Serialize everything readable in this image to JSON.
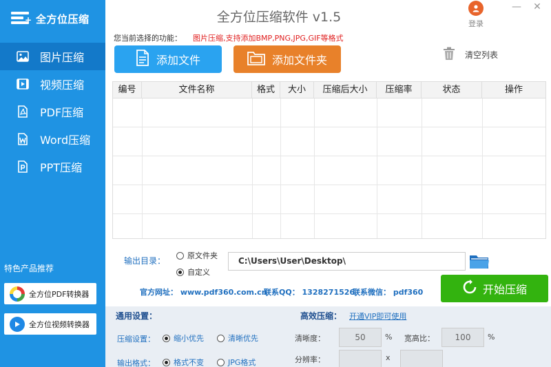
{
  "app": {
    "logo_text": "全方位压缩",
    "title": "全方位压缩软件 v1.5",
    "login_label": "登录",
    "minimize": "—",
    "close": "✕"
  },
  "sidebar": {
    "items": [
      {
        "label": "图片压缩",
        "icon": "image-icon",
        "active": true
      },
      {
        "label": "视频压缩",
        "icon": "video-icon",
        "active": false
      },
      {
        "label": "PDF压缩",
        "icon": "pdf-icon",
        "active": false
      },
      {
        "label": "Word压缩",
        "icon": "word-icon",
        "active": false
      },
      {
        "label": "PPT压缩",
        "icon": "ppt-icon",
        "active": false
      }
    ],
    "promo_title": "特色产品推荐",
    "promo": [
      {
        "label": "全方位PDF转换器",
        "icon": "pdf-converter-icon"
      },
      {
        "label": "全方位视频转换器",
        "icon": "video-converter-icon"
      }
    ]
  },
  "toolbar": {
    "func_label": "您当前选择的功能：",
    "func_desc": "图片压缩,支持添加BMP,PNG,JPG,GIF等格式",
    "add_file": "添加文件",
    "add_folder": "添加文件夹",
    "clear_list": "清空列表"
  },
  "table": {
    "columns": [
      "编号",
      "文件名称",
      "格式",
      "大小",
      "压缩后大小",
      "压缩率",
      "状态",
      "操作"
    ],
    "rows": []
  },
  "output": {
    "label": "输出目录：",
    "option_original": "原文件夹",
    "option_custom": "自定义",
    "selected": "custom",
    "path": "C:\\Users\\User\\Desktop\\"
  },
  "info": {
    "website": "官方网址：  www.pdf360.com.cn",
    "qq": "联系QQ：  1328271526",
    "wechat": "联系微信：  pdf360"
  },
  "start_label": "开始压缩",
  "settings": {
    "general_title": "通用设置：",
    "compress_label": "压缩设置：",
    "compress_opt1": "缩小优先",
    "compress_opt2": "清晰优先",
    "format_label": "输出格式：",
    "format_opt1": "格式不变",
    "format_opt2": "JPG格式",
    "hq_title": "高效压缩：",
    "vip_link": "开通VIP即可使用",
    "clarity_label": "清晰度：",
    "clarity_value": "50",
    "clarity_unit": "%",
    "ratio_label": "宽高比：",
    "ratio_value": "100",
    "ratio_unit": "%",
    "resolution_label": "分辨率：",
    "resolution_x": "x"
  },
  "colors": {
    "sidebar": "#1f93e3",
    "sidebar_active": "#1379c9",
    "add_file": "#2aa3f0",
    "add_folder": "#e8812a",
    "start": "#33b30f",
    "warning_text": "#e02020"
  }
}
